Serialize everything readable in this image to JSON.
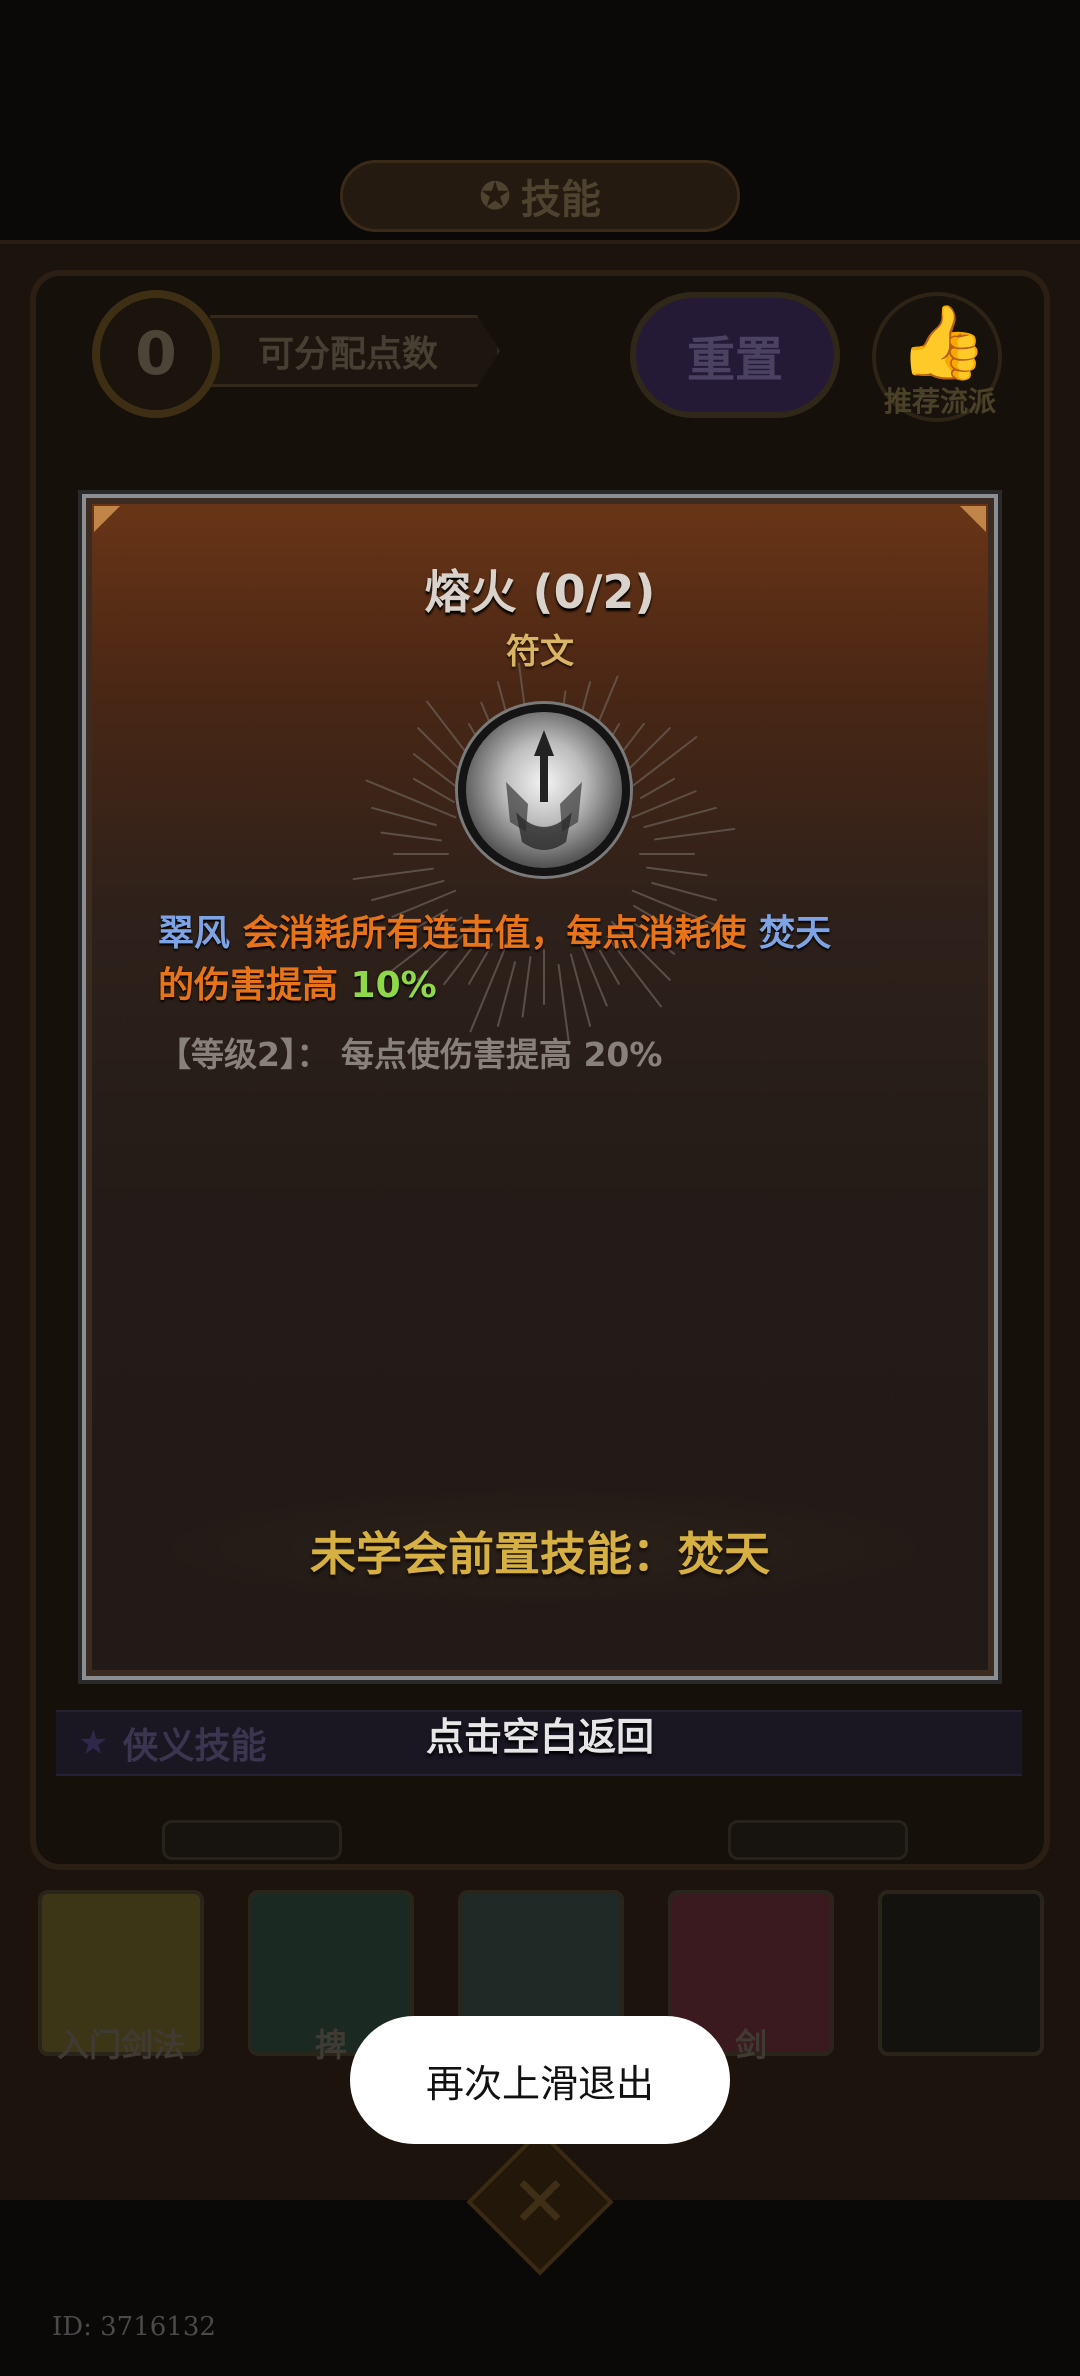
{
  "header": {
    "title": "技能",
    "title_icon": "gear-icon"
  },
  "points": {
    "value": "0",
    "label": "可分配点数"
  },
  "reset_button": {
    "label": "重置"
  },
  "recommend": {
    "label": "推荐流派",
    "icon": "thumbs-up-icon"
  },
  "dialog": {
    "title": "熔火 (0/2)",
    "type": "符文",
    "description": {
      "part1": "翠风",
      "part2": " 会消耗所有连击值，每点消耗使 ",
      "part3": "焚天",
      "part4": "的伤害提高 ",
      "part5": "10%"
    },
    "level_info": "【等级2】： 每点使伤害提高 20%",
    "prerequisite": "未学会前置技能：焚天",
    "colors": {
      "blue": "#7ea4e6",
      "orange": "#e8741a",
      "green": "#8fd84a",
      "gold": "#d6b043"
    }
  },
  "tap_back": "点击空白返回",
  "skill_bar": {
    "label": "侠义技能"
  },
  "skills": [
    {
      "name": "入门剑法",
      "color": "#3c3616"
    },
    {
      "name": "捭",
      "color": "#1a2a22"
    },
    {
      "name": "",
      "color": "#1f2a26"
    },
    {
      "name": "剑",
      "color": "#3a1a1e"
    },
    {
      "name": "",
      "color": "#14120e"
    }
  ],
  "toast": "再次上滑退出",
  "footer_id": "ID: 3716132"
}
